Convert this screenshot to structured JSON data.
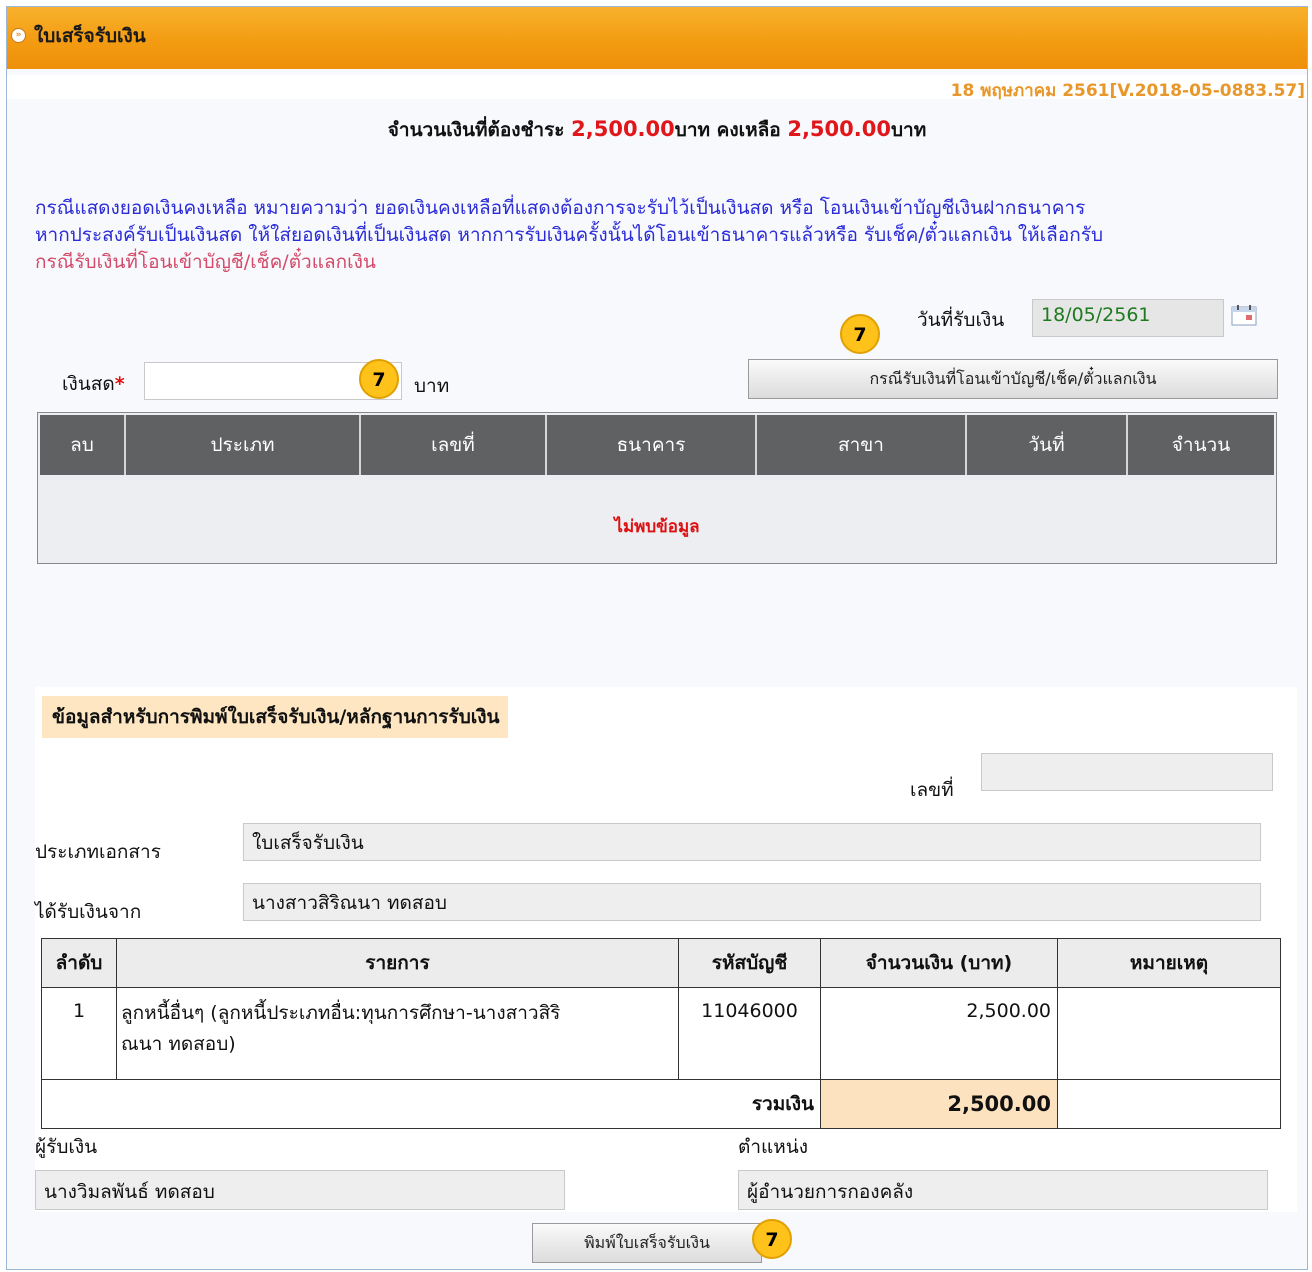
{
  "header": {
    "title": "ใบเสร็จรับเงิน",
    "version": "18 พฤษภาคม 2561[V.2018-05-0883.57]"
  },
  "summary": {
    "prefix": "จำนวนเงินที่ต้องชำระ",
    "amount_due": "2,500.00",
    "unit1": "บาท คงเหลือ",
    "remaining": "2,500.00",
    "unit2": "บาท"
  },
  "note": {
    "line1": "กรณีแสดงยอดเงินคงเหลือ หมายความว่า ยอดเงินคงเหลือที่แสดงต้องการจะรับไว้เป็นเงินสด หรือ โอนเงินเข้าบัญชีเงินฝากธนาคาร",
    "line2": "หากประสงค์รับเป็นเงินสด ให้ใส่ยอดเงินที่เป็นเงินสด หากการรับเงินครั้งนั้นได้โอนเข้าธนาคารแล้วหรือ รับเช็ค/ตั๋วแลกเงิน ให้เลือกรับ",
    "line3": "กรณีรับเงินที่โอนเข้าบัญชี/เช็ค/ตั๋วแลกเงิน"
  },
  "receive_date": {
    "label": "วันที่รับเงิน",
    "value": "18/05/2561"
  },
  "cash": {
    "label": "เงินสด",
    "required": "*",
    "value": "",
    "unit": "บาท"
  },
  "transfer_button": "กรณีรับเงินที่โอนเข้าบัญชี/เช็ค/ตั๋วแลกเงิน",
  "badges": {
    "cash": "7",
    "transfer": "7",
    "print": "7"
  },
  "payment_table": {
    "columns": [
      "ลบ",
      "ประเภท",
      "เลขที่",
      "ธนาคาร",
      "สาขา",
      "วันที่",
      "จำนวน"
    ],
    "empty": "ไม่พบข้อมูล"
  },
  "print_section": {
    "title": "ข้อมูลสำหรับการพิมพ์ใบเสร็จรับเงิน/หลักฐานการรับเงิน",
    "number_label": "เลขที่",
    "number_value": "",
    "doc_type_label": "ประเภทเอกสาร",
    "doc_type_value": "ใบเสร็จรับเงิน",
    "from_label": "ได้รับเงินจาก",
    "from_value": "นางสาวสิริณนา ทดสอบ",
    "table": {
      "columns": [
        "ลำดับ",
        "รายการ",
        "รหัสบัญชี",
        "จำนวนเงิน (บาท)",
        "หมายเหตุ"
      ],
      "rows": [
        {
          "no": "1",
          "item_line1": "ลูกหนี้อื่นๆ (ลูกหนี้ประเภทอื่น:ทุนการศึกษา-นางสาวสิริ",
          "item_line2": "ณนา ทดสอบ)",
          "account": "11046000",
          "amount": "2,500.00",
          "remark": ""
        }
      ],
      "total_label": "รวมเงิน",
      "total_value": "2,500.00"
    },
    "receiver_label": "ผู้รับเงิน",
    "receiver_value": "นางวิมลพันธ์  ทดสอบ",
    "position_label": "ตำแหน่ง",
    "position_value": "ผู้อำนวยการกองคลัง"
  },
  "print_button": "พิมพ์ใบเสร็จรับเงิน"
}
